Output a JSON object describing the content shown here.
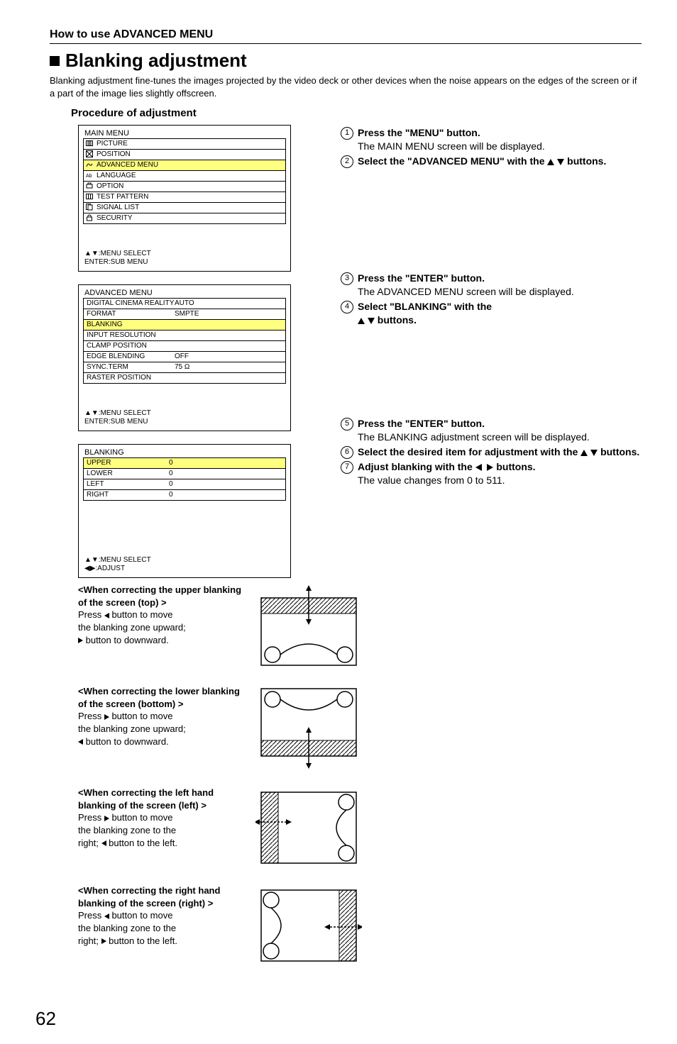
{
  "section_title": "How to use ADVANCED MENU",
  "main_heading": "Blanking adjustment",
  "intro": "Blanking adjustment fine-tunes the images projected by the video deck or other devices when the noise appears on the edges of the screen or if a part of the image lies slightly offscreen.",
  "subheading": "Procedure of adjustment",
  "main_menu": {
    "title": "MAIN MENU",
    "items": [
      "PICTURE",
      "POSITION",
      "ADVANCED MENU",
      "LANGUAGE",
      "OPTION",
      "TEST PATTERN",
      "SIGNAL LIST",
      "SECURITY"
    ],
    "footer1": "▲▼:MENU SELECT",
    "footer2": "ENTER:SUB MENU"
  },
  "adv_menu": {
    "title": "ADVANCED MENU",
    "items": [
      {
        "label": "DIGITAL CINEMA REALITY",
        "value": "AUTO"
      },
      {
        "label": "FORMAT",
        "value": "SMPTE"
      },
      {
        "label": "BLANKING",
        "value": ""
      },
      {
        "label": "INPUT RESOLUTION",
        "value": ""
      },
      {
        "label": "CLAMP POSITION",
        "value": ""
      },
      {
        "label": "EDGE BLENDING",
        "value": "OFF"
      },
      {
        "label": "SYNC.TERM",
        "value": "75 Ω"
      },
      {
        "label": "RASTER POSITION",
        "value": ""
      }
    ],
    "footer1": "▲▼:MENU SELECT",
    "footer2": "ENTER:SUB MENU"
  },
  "blanking_menu": {
    "title": "BLANKING",
    "items": [
      {
        "label": "UPPER",
        "value": "0"
      },
      {
        "label": "LOWER",
        "value": "0"
      },
      {
        "label": "LEFT",
        "value": "0"
      },
      {
        "label": "RIGHT",
        "value": "0"
      }
    ],
    "footer1": "▲▼:MENU SELECT",
    "footer2": "◀▶:ADJUST"
  },
  "steps": {
    "s1_b": "Press the \"MENU\" button.",
    "s1_d": "The MAIN MENU screen will be displayed.",
    "s2_b1": "Select the \"ADVANCED MENU\" with the ",
    "s2_b2": " buttons.",
    "s3_b": "Press the \"ENTER\" button.",
    "s3_d": "The ADVANCED MENU screen will be displayed.",
    "s4_b1": "Select \"BLANKING\" with the",
    "s4_b2": " buttons.",
    "s5_b": "Press the \"ENTER\" button.",
    "s5_d": "The BLANKING adjustment screen will be displayed.",
    "s6_b1": "Select the desired item for adjustment with the ",
    "s6_b2": " buttons.",
    "s7_b1": "Adjust blanking with the ",
    "s7_b2": " buttons.",
    "s7_d": "The value changes from 0 to 511."
  },
  "quads": {
    "top": {
      "title": "<When correcting the upper blanking of the screen (top) >",
      "l1a": "Press ",
      "l1b": " button to move",
      "l2": "the blanking zone upward;",
      "l3a": "",
      "l3b": " button to downward."
    },
    "bottom": {
      "title": "<When correcting the lower blanking of the screen (bottom) >",
      "l1a": "Press ",
      "l1b": " button to move",
      "l2": "the blanking zone upward;",
      "l3a": "",
      "l3b": " button to downward."
    },
    "left": {
      "title": "<When correcting the left hand blanking of the screen (left) >",
      "l1a": "Press ",
      "l1b": " button to move",
      "l2": "the blanking zone to the",
      "l3a": "right; ",
      "l3b": " button to the left."
    },
    "right": {
      "title": "<When correcting the right hand blanking of the screen (right) >",
      "l1a": "Press ",
      "l1b": " button to move",
      "l2": "the blanking zone to the",
      "l3a": "right; ",
      "l3b": " button to the left."
    }
  },
  "page_number": "62"
}
